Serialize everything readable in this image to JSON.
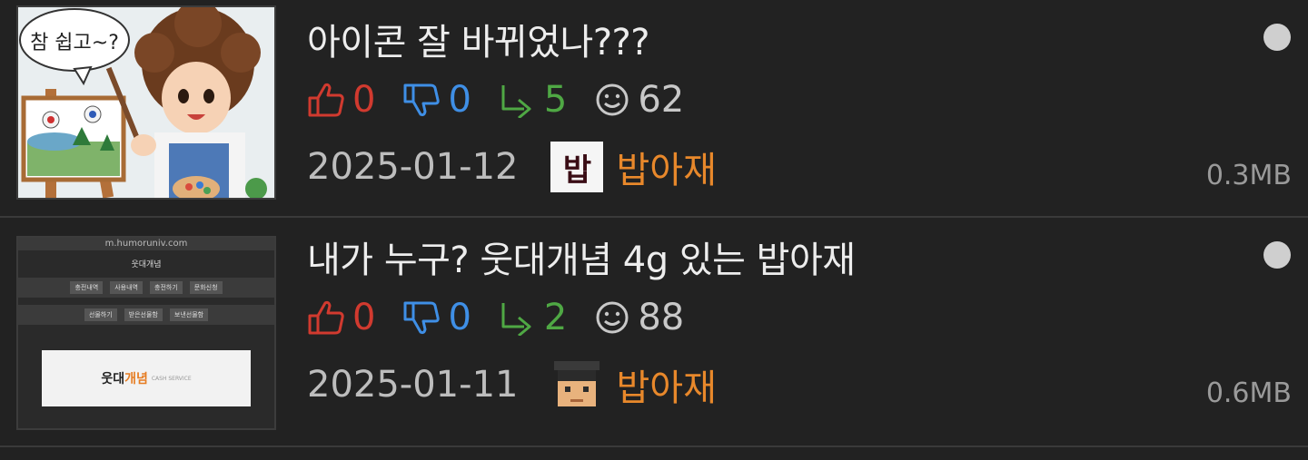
{
  "posts": [
    {
      "title": "아이콘 잘 바뀌었나???",
      "upvotes": "0",
      "downvotes": "0",
      "replies": "5",
      "views": "62",
      "date": "2025-01-12",
      "avatar_text": "밥",
      "author": "밥아재",
      "size": "0.3MB",
      "thumb_caption": "참 쉽고~?"
    },
    {
      "title": "내가 누구? 웃대개념 4g 있는 밥아재",
      "upvotes": "0",
      "downvotes": "0",
      "replies": "2",
      "views": "88",
      "date": "2025-01-11",
      "author": "밥아재",
      "size": "0.6MB",
      "thumb": {
        "url": "m.humoruniv.com",
        "header": "웃대개념",
        "buttons_row1": [
          "충전내역",
          "사용내역",
          "충전하기",
          "문화신청"
        ],
        "buttons_row2": [
          "선물하기",
          "받은선물함",
          "보낸선물함"
        ],
        "banner_main": "웃대",
        "banner_accent": "개념",
        "banner_sub": "CASH SERVICE"
      }
    }
  ],
  "colors": {
    "upvote": "#d13a2f",
    "downvote": "#3f8fe6",
    "reply": "#4fa844",
    "author": "#e8882b",
    "background": "#222222"
  },
  "icons": {
    "upvote": "thumbs-up-icon",
    "downvote": "thumbs-down-icon",
    "reply": "reply-arrow-icon",
    "views": "smiley-icon",
    "unread": "unread-dot-icon"
  }
}
